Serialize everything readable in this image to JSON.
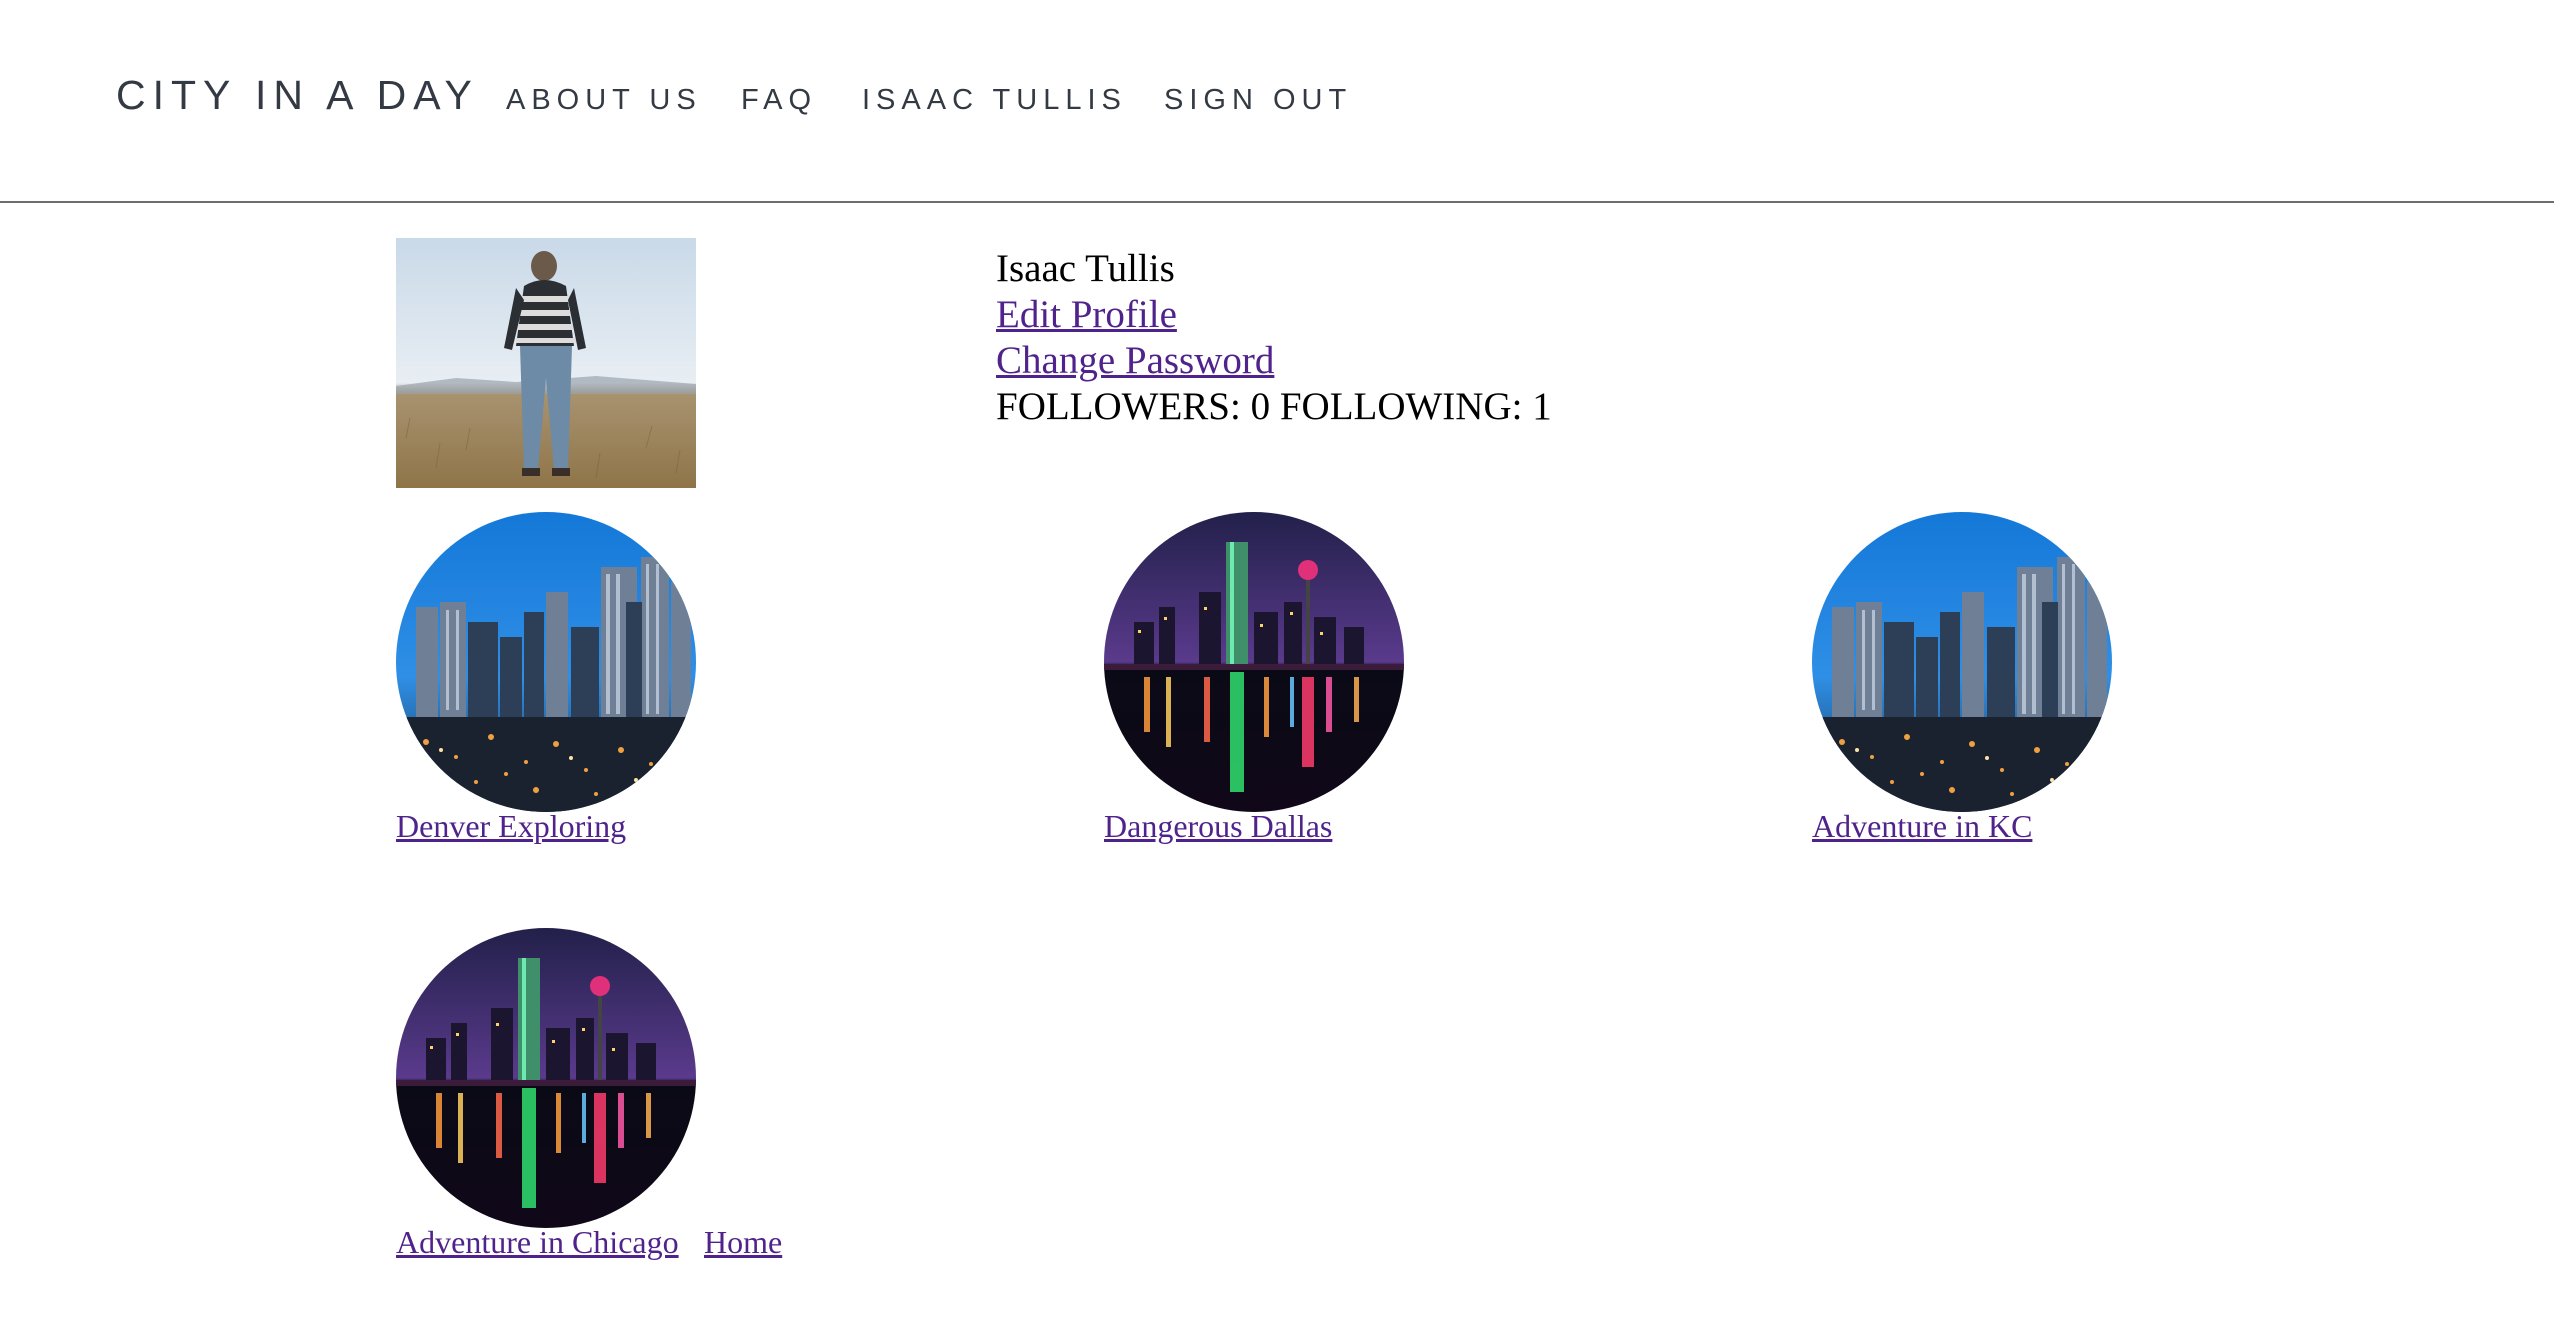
{
  "header": {
    "brand": "CITY IN A DAY",
    "nav": [
      {
        "label": "ABOUT US"
      },
      {
        "label": "FAQ"
      },
      {
        "label": "ISAAC TULLIS"
      },
      {
        "label": "SIGN OUT"
      }
    ]
  },
  "profile": {
    "name": "Isaac Tullis",
    "edit_profile": "Edit Profile",
    "change_password": "Change Password",
    "stats": "FOLLOWERS: 0 FOLLOWING: 1"
  },
  "trips": [
    {
      "title": "Denver Exploring",
      "image": "denver-skyline"
    },
    {
      "title": "Dangerous Dallas",
      "image": "dallas-night-skyline"
    },
    {
      "title": "Adventure in KC",
      "image": "denver-skyline"
    },
    {
      "title": "Adventure in Chicago",
      "image": "dallas-night-skyline"
    }
  ],
  "footer": {
    "home": "Home"
  },
  "colors": {
    "nav_text": "#333a44",
    "link_visited": "#50238c",
    "divider": "#6d6d6d"
  }
}
